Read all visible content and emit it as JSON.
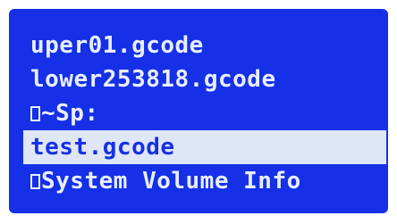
{
  "screen": {
    "background_color": "#1530e6",
    "text_color": "#e8eeff",
    "highlight_color": "#dfe6f5"
  },
  "file_list": {
    "items": [
      {
        "label": "uper01.gcode",
        "type": "file",
        "selected": false
      },
      {
        "label": "lower253818.gcode",
        "type": "file",
        "selected": false
      },
      {
        "label": "~Sp:",
        "type": "folder",
        "icon": "folder-icon",
        "selected": false
      },
      {
        "label": "test.gcode",
        "type": "file",
        "selected": true
      },
      {
        "label": "System Volume Info",
        "type": "folder",
        "icon": "folder-icon",
        "selected": false
      }
    ]
  }
}
